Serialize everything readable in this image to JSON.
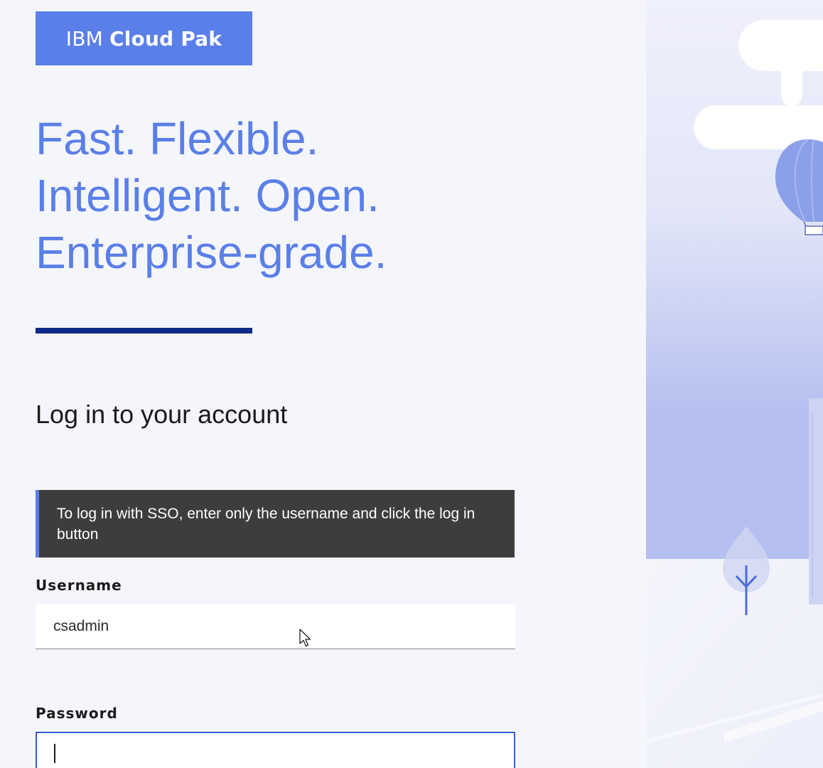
{
  "brand": {
    "name_light": "IBM",
    "name_bold": "Cloud Pak"
  },
  "hero": {
    "lines": [
      "Fast. Flexible.",
      "Intelligent. Open.",
      "Enterprise-grade."
    ]
  },
  "login": {
    "title": "Log in to your account",
    "sso_notice": "To log in with SSO, enter only the username and click the log in button",
    "username_label": "Username",
    "username_value": "csadmin",
    "password_label": "Password",
    "password_value": ""
  },
  "colors": {
    "brand_blue": "#5a7fe8",
    "divider_navy": "#0e2b8a",
    "notice_bg": "#3d3d3d",
    "focus_border": "#3a5fd0"
  }
}
